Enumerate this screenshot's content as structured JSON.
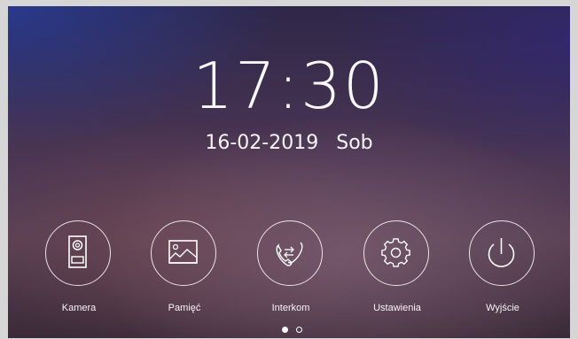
{
  "clock": {
    "time": "17:30",
    "date": "16-02-2019",
    "weekday": "Sob"
  },
  "menu": [
    {
      "label": "Kamera",
      "icon": "door-camera-icon"
    },
    {
      "label": "Pamięć",
      "icon": "picture-icon"
    },
    {
      "label": "Interkom",
      "icon": "intercom-icon"
    },
    {
      "label": "Ustawienia",
      "icon": "gear-icon"
    },
    {
      "label": "Wyjście",
      "icon": "power-icon"
    }
  ],
  "pager": {
    "pages": 2,
    "current": 1
  },
  "colors": {
    "text": "#ffffff",
    "bezel": "#d6d6d6"
  }
}
